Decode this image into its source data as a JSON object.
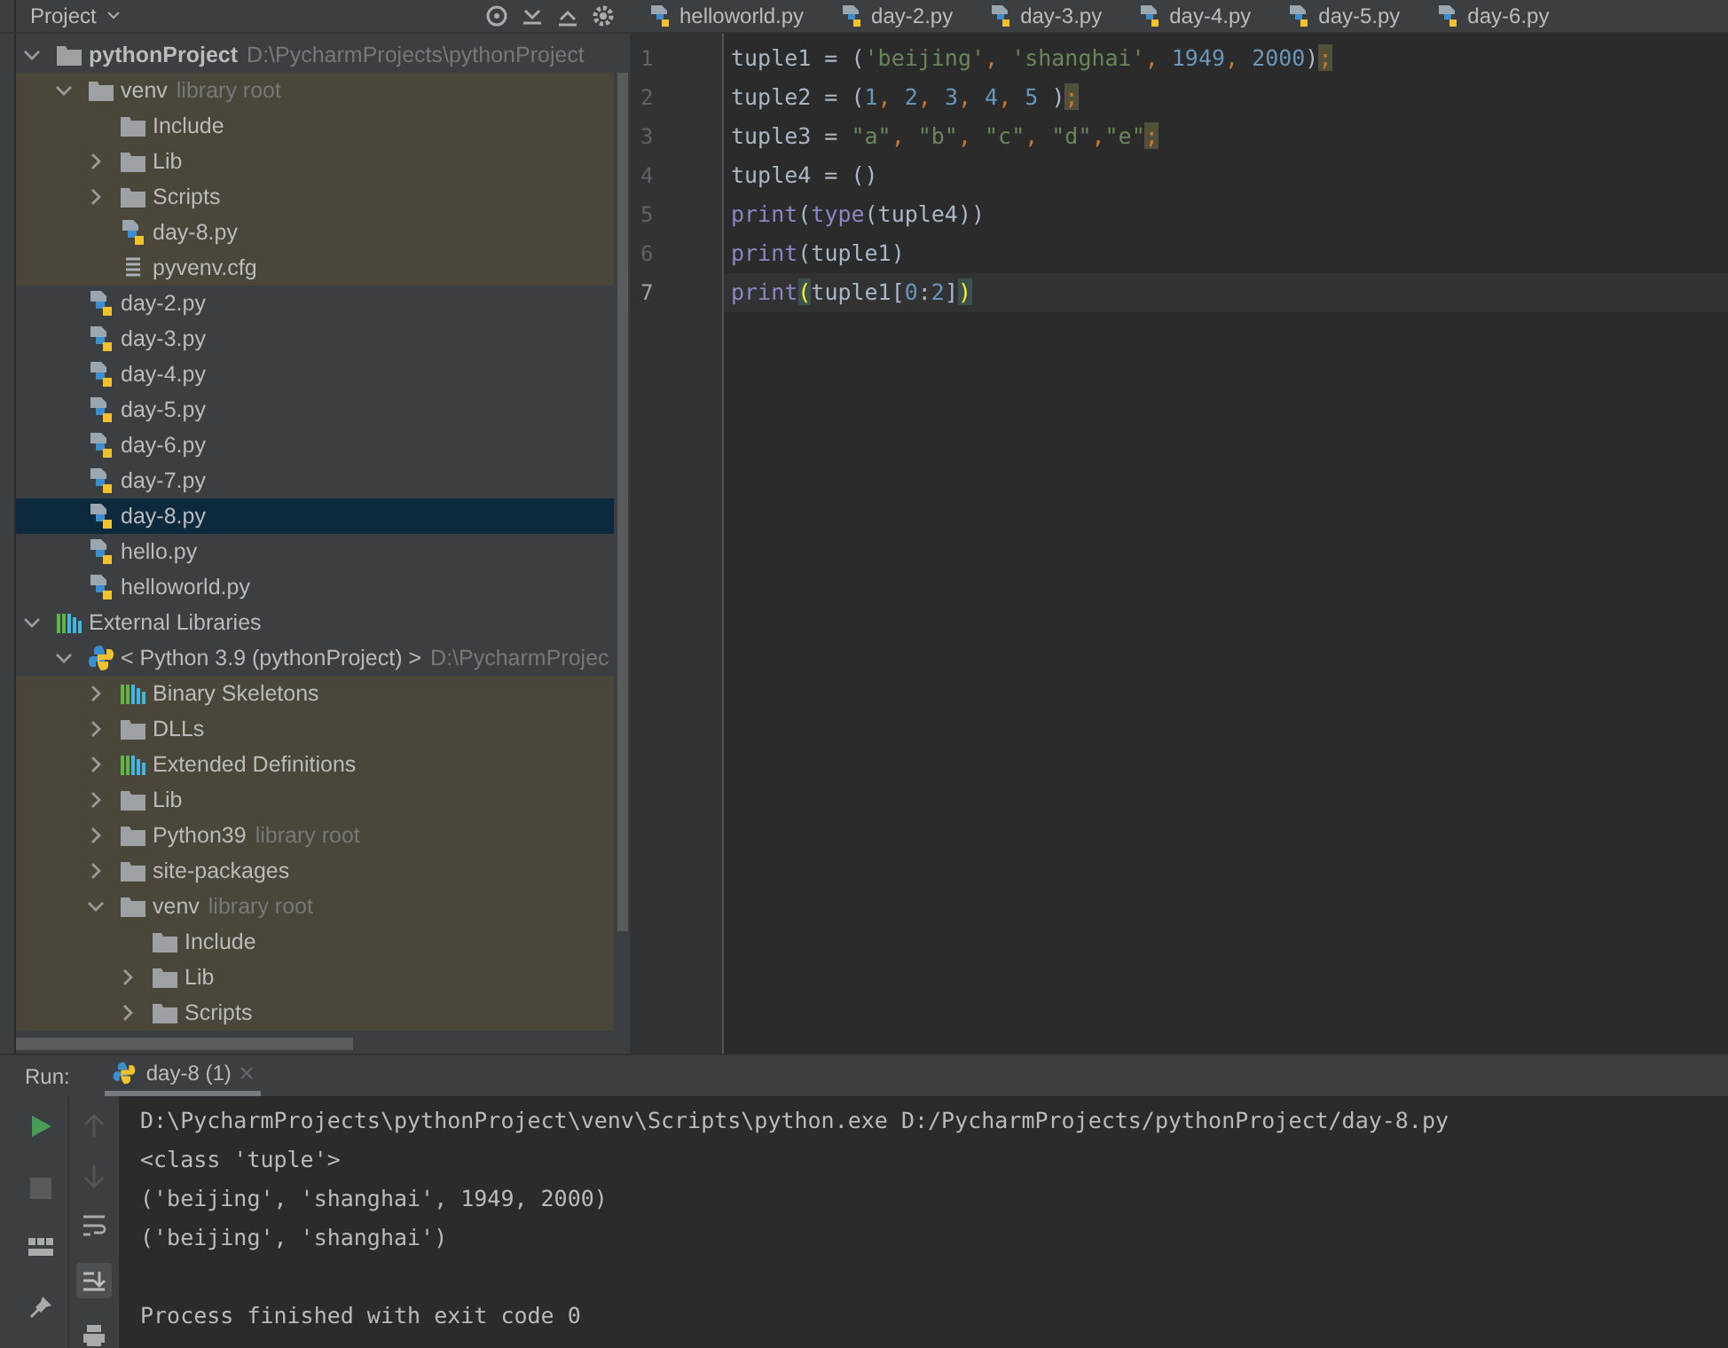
{
  "project_panel": {
    "title": "Project",
    "tree": [
      {
        "name": "pythonProject",
        "detail": "D:\\PycharmProjects\\pythonProject",
        "kind": "folder",
        "bold": true,
        "expanded": true,
        "selected": false,
        "shaded": false,
        "children": [
          {
            "name": "venv",
            "detail": "library root",
            "kind": "folder",
            "expanded": true,
            "selected": false,
            "shaded": true,
            "children": [
              {
                "name": "Include",
                "kind": "folder",
                "selected": false,
                "shaded": true
              },
              {
                "name": "Lib",
                "kind": "folder",
                "expanded": false,
                "selected": false,
                "shaded": true
              },
              {
                "name": "Scripts",
                "kind": "folder",
                "expanded": false,
                "selected": false,
                "shaded": true
              },
              {
                "name": "day-8.py",
                "kind": "python",
                "selected": false,
                "shaded": true
              },
              {
                "name": "pyvenv.cfg",
                "kind": "text",
                "selected": false,
                "shaded": true
              }
            ]
          },
          {
            "name": "day-2.py",
            "kind": "python",
            "selected": false,
            "shaded": false
          },
          {
            "name": "day-3.py",
            "kind": "python",
            "selected": false,
            "shaded": false
          },
          {
            "name": "day-4.py",
            "kind": "python",
            "selected": false,
            "shaded": false
          },
          {
            "name": "day-5.py",
            "kind": "python",
            "selected": false,
            "shaded": false
          },
          {
            "name": "day-6.py",
            "kind": "python",
            "selected": false,
            "shaded": false
          },
          {
            "name": "day-7.py",
            "kind": "python",
            "selected": false,
            "shaded": false
          },
          {
            "name": "day-8.py",
            "kind": "python",
            "selected": true,
            "shaded": false
          },
          {
            "name": "hello.py",
            "kind": "python",
            "selected": false,
            "shaded": false
          },
          {
            "name": "helloworld.py",
            "kind": "python",
            "selected": false,
            "shaded": false
          }
        ]
      },
      {
        "name": "External Libraries",
        "kind": "library",
        "expanded": true,
        "selected": false,
        "shaded": false,
        "children": [
          {
            "name": "< Python 3.9 (pythonProject) >",
            "detail": "D:\\PycharmProjec",
            "kind": "sdk",
            "expanded": true,
            "selected": false,
            "shaded": false,
            "children": [
              {
                "name": "Binary Skeletons",
                "kind": "library",
                "expanded": false,
                "selected": false,
                "shaded": true
              },
              {
                "name": "DLLs",
                "kind": "folder",
                "expanded": false,
                "selected": false,
                "shaded": true
              },
              {
                "name": "Extended Definitions",
                "kind": "library",
                "expanded": false,
                "selected": false,
                "shaded": true
              },
              {
                "name": "Lib",
                "kind": "folder",
                "expanded": false,
                "selected": false,
                "shaded": true
              },
              {
                "name": "Python39",
                "detail": "library root",
                "kind": "folder",
                "expanded": false,
                "selected": false,
                "shaded": true
              },
              {
                "name": "site-packages",
                "kind": "folder",
                "expanded": false,
                "selected": false,
                "shaded": true
              },
              {
                "name": "venv",
                "detail": "library root",
                "kind": "folder",
                "expanded": true,
                "selected": false,
                "shaded": true,
                "children": [
                  {
                    "name": "Include",
                    "kind": "folder",
                    "selected": false,
                    "shaded": true
                  },
                  {
                    "name": "Lib",
                    "kind": "folder",
                    "expanded": false,
                    "selected": false,
                    "shaded": true
                  },
                  {
                    "name": "Scripts",
                    "kind": "folder",
                    "expanded": false,
                    "selected": false,
                    "shaded": true
                  }
                ]
              }
            ]
          }
        ]
      }
    ]
  },
  "editor_tabs": [
    {
      "label": "helloworld.py",
      "selected": false
    },
    {
      "label": "day-2.py",
      "selected": false
    },
    {
      "label": "day-3.py",
      "selected": false
    },
    {
      "label": "day-4.py",
      "selected": false
    },
    {
      "label": "day-5.py",
      "selected": false
    },
    {
      "label": "day-6.py",
      "selected": false
    }
  ],
  "editor": {
    "lines": [
      {
        "number": "1",
        "current": false,
        "tokens": [
          {
            "kind": "plain",
            "text": "tuple1 = ("
          },
          {
            "kind": "string",
            "text": "'beijing'"
          },
          {
            "kind": "punct",
            "text": ", "
          },
          {
            "kind": "string",
            "text": "'shanghai'"
          },
          {
            "kind": "punct",
            "text": ", "
          },
          {
            "kind": "number",
            "text": "1949"
          },
          {
            "kind": "punct",
            "text": ", "
          },
          {
            "kind": "number",
            "text": "2000"
          },
          {
            "kind": "plain",
            "text": ")"
          },
          {
            "kind": "warn",
            "text": ";"
          }
        ]
      },
      {
        "number": "2",
        "current": false,
        "tokens": [
          {
            "kind": "plain",
            "text": "tuple2 = ("
          },
          {
            "kind": "number",
            "text": "1"
          },
          {
            "kind": "punct",
            "text": ", "
          },
          {
            "kind": "number",
            "text": "2"
          },
          {
            "kind": "punct",
            "text": ", "
          },
          {
            "kind": "number",
            "text": "3"
          },
          {
            "kind": "punct",
            "text": ", "
          },
          {
            "kind": "number",
            "text": "4"
          },
          {
            "kind": "punct",
            "text": ", "
          },
          {
            "kind": "number",
            "text": "5"
          },
          {
            "kind": "plain",
            "text": " )"
          },
          {
            "kind": "warn",
            "text": ";"
          }
        ]
      },
      {
        "number": "3",
        "current": false,
        "tokens": [
          {
            "kind": "plain",
            "text": "tuple3 = "
          },
          {
            "kind": "string",
            "text": "\"a\""
          },
          {
            "kind": "punct",
            "text": ", "
          },
          {
            "kind": "string",
            "text": "\"b\""
          },
          {
            "kind": "punct",
            "text": ", "
          },
          {
            "kind": "string",
            "text": "\"c\""
          },
          {
            "kind": "punct",
            "text": ", "
          },
          {
            "kind": "string",
            "text": "\"d\""
          },
          {
            "kind": "punct",
            "text": ","
          },
          {
            "kind": "string",
            "text": "\"e\""
          },
          {
            "kind": "warn",
            "text": ";"
          }
        ]
      },
      {
        "number": "4",
        "current": false,
        "tokens": [
          {
            "kind": "plain",
            "text": "tuple4 = ()"
          }
        ]
      },
      {
        "number": "5",
        "current": false,
        "tokens": [
          {
            "kind": "builtin",
            "text": "print"
          },
          {
            "kind": "plain",
            "text": "("
          },
          {
            "kind": "builtin",
            "text": "type"
          },
          {
            "kind": "plain",
            "text": "(tuple4))"
          }
        ]
      },
      {
        "number": "6",
        "current": false,
        "tokens": [
          {
            "kind": "builtin",
            "text": "print"
          },
          {
            "kind": "plain",
            "text": "(tuple1)"
          }
        ]
      },
      {
        "number": "7",
        "current": true,
        "tokens": [
          {
            "kind": "builtin",
            "text": "print"
          },
          {
            "kind": "brace",
            "text": "("
          },
          {
            "kind": "plain",
            "text": "tuple1["
          },
          {
            "kind": "number",
            "text": "0"
          },
          {
            "kind": "plain",
            "text": ":"
          },
          {
            "kind": "number",
            "text": "2"
          },
          {
            "kind": "plain",
            "text": "]"
          },
          {
            "kind": "brace",
            "text": ")"
          }
        ]
      }
    ]
  },
  "run_panel": {
    "label": "Run:",
    "tab": "day-8 (1)",
    "output": [
      {
        "kind": "command",
        "text": "D:\\PycharmProjects\\pythonProject\\venv\\Scripts\\python.exe D:/PycharmProjects/pythonProject/day-8.py"
      },
      {
        "kind": "output",
        "text": "<class 'tuple'>"
      },
      {
        "kind": "output",
        "text": "('beijing', 'shanghai', 1949, 2000)"
      },
      {
        "kind": "output",
        "text": "('beijing', 'shanghai')"
      },
      {
        "kind": "exit",
        "text": "Process finished with exit code 0"
      }
    ]
  }
}
